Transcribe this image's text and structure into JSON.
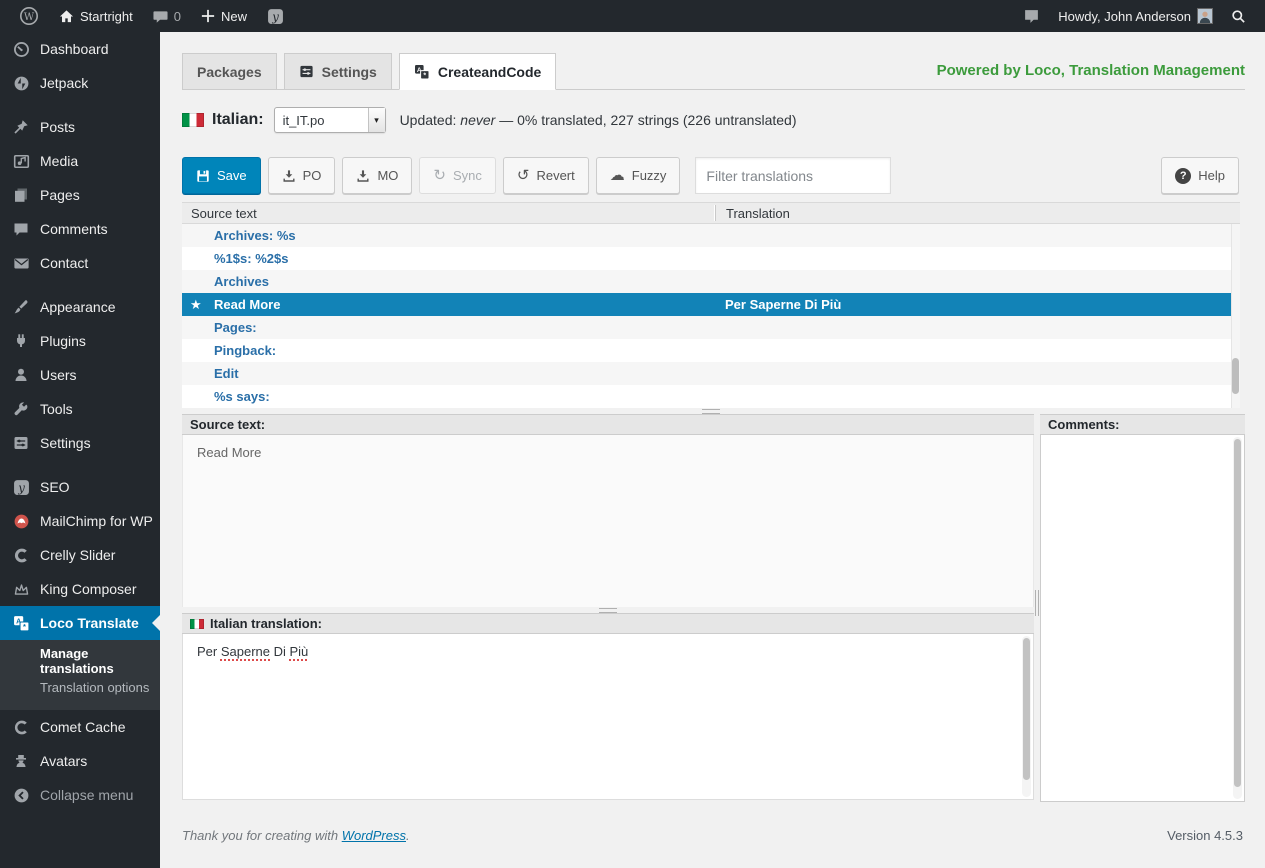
{
  "adminbar": {
    "site_name": "Startright",
    "comments_count": "0",
    "new_label": "New",
    "howdy": "Howdy, John Anderson"
  },
  "sidebar": {
    "group1": [
      {
        "label": "Dashboard"
      },
      {
        "label": "Jetpack"
      }
    ],
    "group2": [
      {
        "label": "Posts"
      },
      {
        "label": "Media"
      },
      {
        "label": "Pages"
      },
      {
        "label": "Comments"
      },
      {
        "label": "Contact"
      }
    ],
    "group3": [
      {
        "label": "Appearance"
      },
      {
        "label": "Plugins"
      },
      {
        "label": "Users"
      },
      {
        "label": "Tools"
      },
      {
        "label": "Settings"
      }
    ],
    "group4": [
      {
        "label": "SEO"
      },
      {
        "label": "MailChimp for WP"
      },
      {
        "label": "Crelly Slider"
      },
      {
        "label": "King Composer"
      }
    ],
    "loco": {
      "label": "Loco Translate"
    },
    "submenu": [
      {
        "label": "Manage translations"
      },
      {
        "label": "Translation options"
      }
    ],
    "group5": [
      {
        "label": "Comet Cache"
      },
      {
        "label": "Avatars"
      }
    ],
    "collapse": {
      "label": "Collapse menu"
    }
  },
  "tabs": {
    "items": [
      {
        "label": "Packages"
      },
      {
        "label": "Settings"
      },
      {
        "label": "CreateandCode"
      }
    ],
    "powered_by": "Powered by Loco, Translation Management"
  },
  "langbar": {
    "language_label": "Italian:",
    "file_select_value": "it_IT.po",
    "updated_prefix": "Updated:",
    "updated_value": "never",
    "status_rest": "— 0% translated, 227 strings (226 untranslated)"
  },
  "toolbar": {
    "save": "Save",
    "po": "PO",
    "mo": "MO",
    "sync": "Sync",
    "revert": "Revert",
    "fuzzy": "Fuzzy",
    "filter_placeholder": "Filter translations",
    "help": "Help"
  },
  "table": {
    "headers": {
      "source": "Source text",
      "translation": "Translation"
    },
    "rows": [
      {
        "source": "Archives: %s",
        "translation": ""
      },
      {
        "source": "%1$s: %2$s",
        "translation": ""
      },
      {
        "source": "Archives",
        "translation": ""
      },
      {
        "source": "Read More",
        "translation": "Per Saperne Di Più",
        "selected": true,
        "starred": true
      },
      {
        "source": "Pages:",
        "translation": ""
      },
      {
        "source": "Pingback:",
        "translation": ""
      },
      {
        "source": "Edit",
        "translation": ""
      },
      {
        "source": "%s says:",
        "translation": ""
      }
    ]
  },
  "editor": {
    "source_label": "Source text:",
    "source_value": "Read More",
    "translation_label": "Italian translation:",
    "translation_tokens": [
      {
        "text": "Per "
      },
      {
        "text": "Saperne",
        "misspelled": true
      },
      {
        "text": " Di "
      },
      {
        "text": "Più",
        "misspelled": true
      }
    ],
    "comments_label": "Comments:"
  },
  "footer": {
    "thanks_prefix": "Thank you for creating with",
    "wordpress_link": "WordPress",
    "suffix": ".",
    "version": "Version 4.5.3"
  },
  "colors": {
    "adminbar_bg": "#23282d",
    "submenu_bg": "#32373c",
    "menu_active_bg": "#0073aa",
    "primary_button": "#0085ba",
    "selected_row": "#1283b7",
    "row_link_blue": "#2a6fa8",
    "powered_green": "#3c9b3c",
    "flag_green": "#009246",
    "flag_red": "#ce2b37",
    "spellcheck_red": "#dd4b4b"
  }
}
